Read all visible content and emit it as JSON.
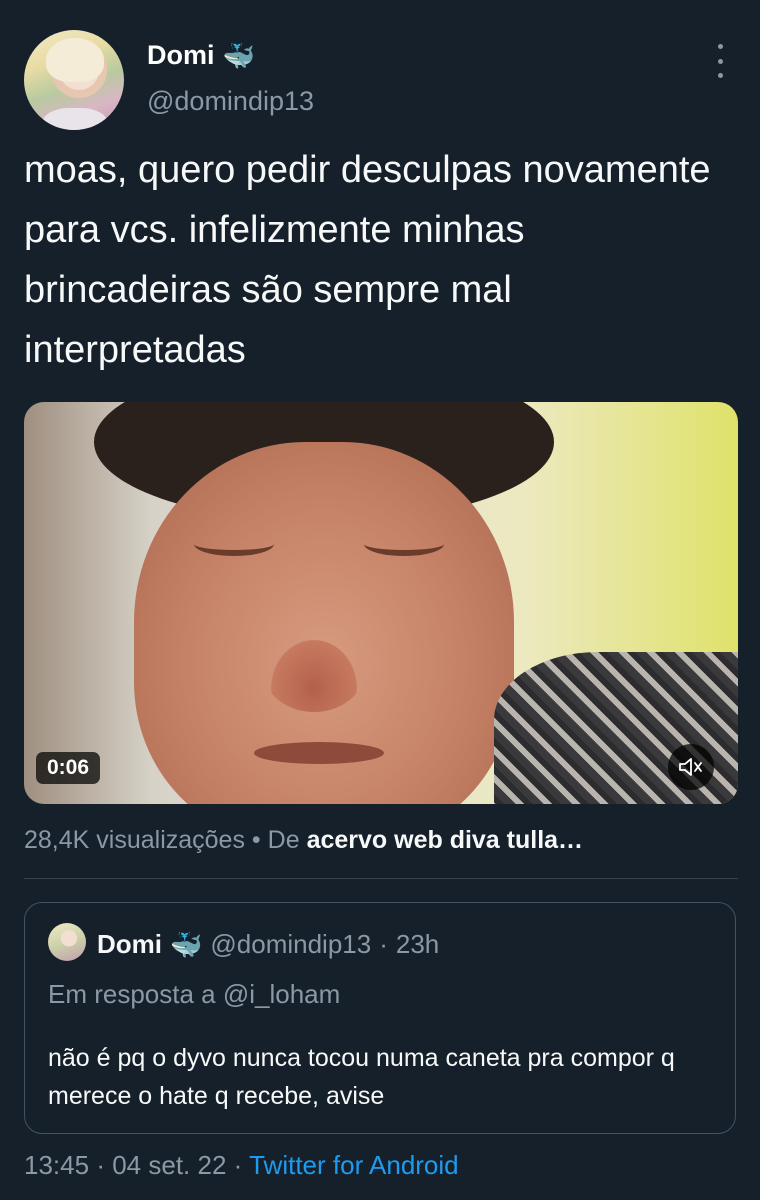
{
  "author": {
    "display_name": "Domi",
    "verified_emoji": "🐳",
    "handle": "@domindip13"
  },
  "tweet": {
    "text": "moas, quero pedir desculpas novamente para vcs. infelizmente minhas brincadeiras são sempre mal interpretadas"
  },
  "media": {
    "duration": "0:06",
    "mute_icon": "speaker-muted-icon"
  },
  "meta": {
    "views": "28,4K visualizações",
    "separator": "•",
    "from_label": "De",
    "source": "acervo web diva tulla…"
  },
  "quote": {
    "display_name": "Domi",
    "verified_emoji": "🐳",
    "handle": "@domindip13",
    "dot": "·",
    "time": "23h",
    "reply_line": "Em resposta a @i_loham",
    "text": "não é pq o dyvo nunca tocou numa caneta pra compor q merece o hate q recebe, avise"
  },
  "footer": {
    "time": "13:45",
    "dot1": "·",
    "date": "04 set. 22",
    "dot2": "·",
    "client": "Twitter for Android"
  },
  "colors": {
    "background": "#15202b",
    "accent": "#1d9bf0",
    "muted_text": "#8b98a5",
    "border": "#38444d"
  }
}
